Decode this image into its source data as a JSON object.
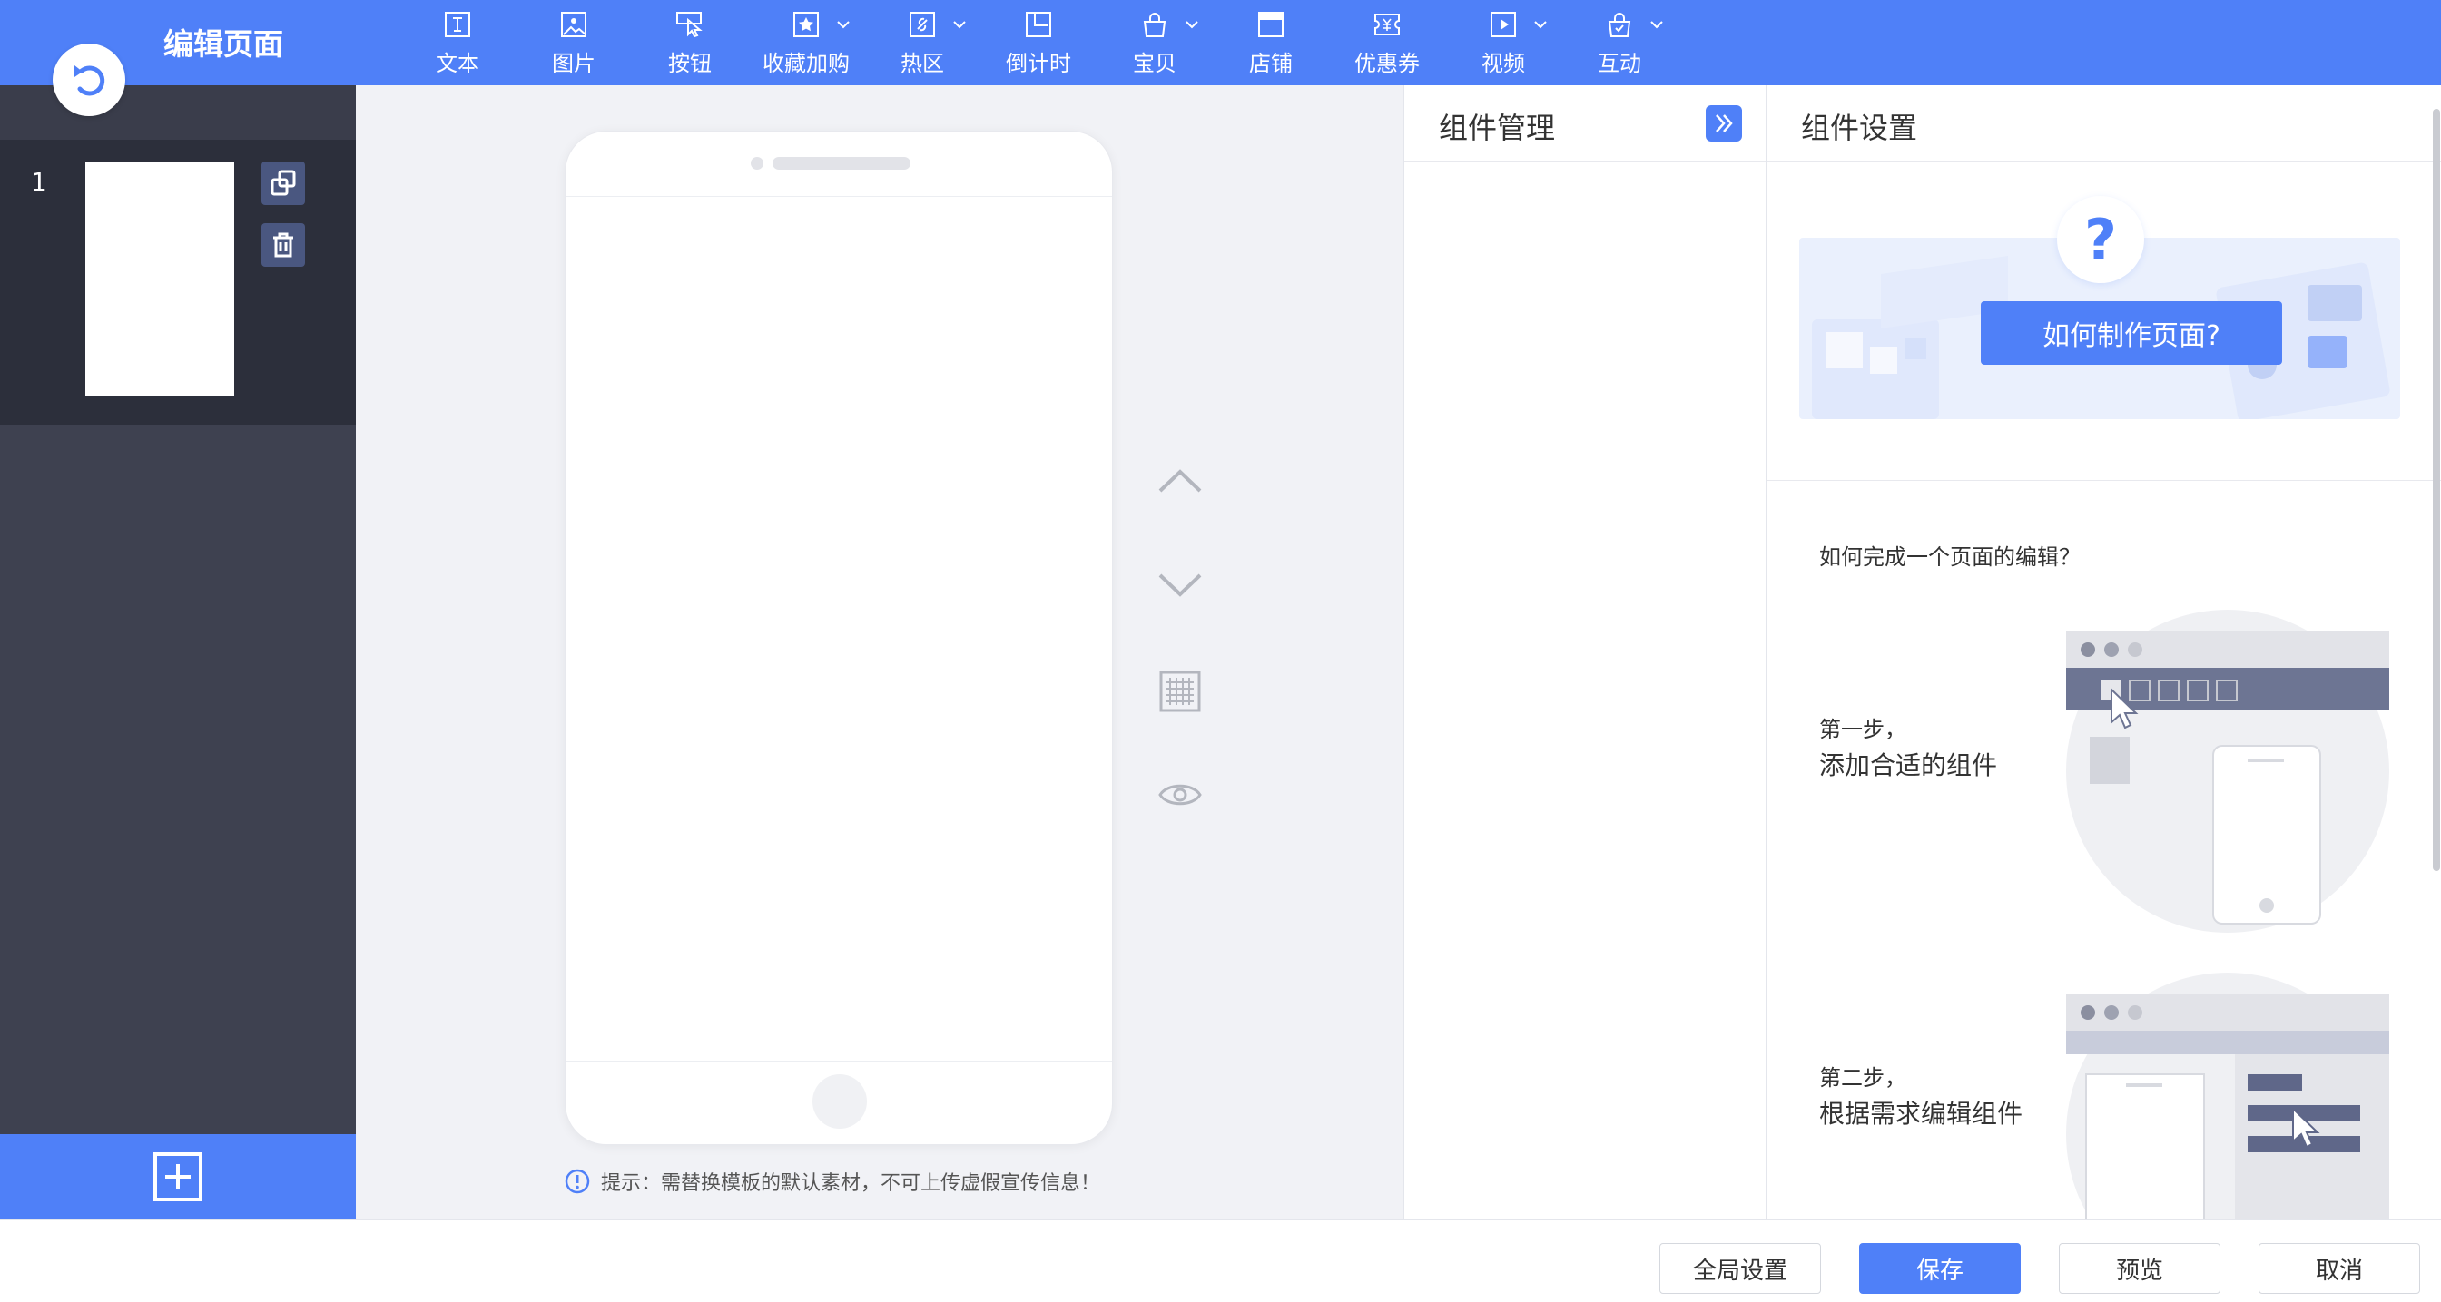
{
  "header": {
    "title": "编辑页面",
    "tools": [
      {
        "label": "文本",
        "icon": "text-icon",
        "dropdown": false
      },
      {
        "label": "图片",
        "icon": "image-icon",
        "dropdown": false
      },
      {
        "label": "按钮",
        "icon": "button-icon",
        "dropdown": false
      },
      {
        "label": "收藏加购",
        "icon": "favorite-icon",
        "dropdown": true
      },
      {
        "label": "热区",
        "icon": "hotspot-icon",
        "dropdown": true
      },
      {
        "label": "倒计时",
        "icon": "countdown-icon",
        "dropdown": false
      },
      {
        "label": "宝贝",
        "icon": "product-icon",
        "dropdown": true
      },
      {
        "label": "店铺",
        "icon": "shop-icon",
        "dropdown": false
      },
      {
        "label": "优惠券",
        "icon": "coupon-icon",
        "dropdown": false
      },
      {
        "label": "视频",
        "icon": "video-icon",
        "dropdown": true
      },
      {
        "label": "互动",
        "icon": "interaction-icon",
        "dropdown": true
      }
    ]
  },
  "sidebar": {
    "pages": [
      {
        "number": "1"
      }
    ]
  },
  "canvas": {
    "tip": "提示：需替换模板的默认素材，不可上传虚假宣传信息！"
  },
  "component_manage": {
    "title": "组件管理"
  },
  "component_settings": {
    "title": "组件设置",
    "banner_button": "如何制作页面?",
    "banner_mark": "?",
    "guide_question": "如何完成一个页面的编辑？",
    "steps": [
      {
        "step": "第一步，",
        "desc": "添加合适的组件"
      },
      {
        "step": "第二步，",
        "desc": "根据需求编辑组件"
      }
    ]
  },
  "footer": {
    "global_settings": "全局设置",
    "save": "保存",
    "preview": "预览",
    "cancel": "取消"
  },
  "colors": {
    "primary": "#4f80f8",
    "sidebar": "#3e4150",
    "sidebar_active": "#2c2f3b"
  }
}
